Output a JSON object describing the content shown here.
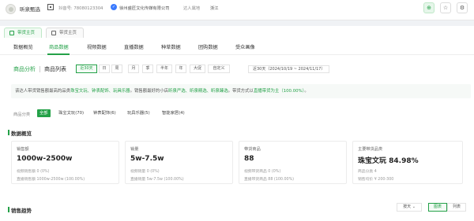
{
  "header": {
    "shop_name": "昕泉甄选",
    "account_label": "抖音号: 78080123304",
    "company": "徐州盛匠文化传媒有限公司",
    "talent_region_label": "达人属地",
    "region": "浙江",
    "icons": [
      "user-plus-icon",
      "star-icon",
      "gear-icon"
    ]
  },
  "host_tabs": [
    {
      "label": "带货主页",
      "active": true
    },
    {
      "label": "带货主页",
      "active": false
    }
  ],
  "tabs": [
    "数据概览",
    "商品数据",
    "视频数据",
    "直播数据",
    "种草数据",
    "团购数据",
    "受众画像"
  ],
  "sub": {
    "analysis": "商品分析",
    "list": "商品列表",
    "periods": [
      "近30天",
      "日",
      "周",
      "月",
      "季",
      "半年",
      "年",
      "大促",
      "自定义"
    ],
    "range": "近30天（2024/10/19 ~ 2024/11/17）"
  },
  "info": {
    "p1": "该达人带货销售额最高的品类",
    "cats": "珠宝文玩、钟表配饰、玩具乐器",
    "p2": "。销售额最好的小店",
    "shops": "昕泉严选、昕泉精选、昕泉臻选",
    "p3": "。带货方式以",
    "mode": "直播带货为主（100.00%）",
    "p4": "。"
  },
  "category": {
    "label": "商品分类",
    "chips": [
      "全部",
      "珠宝文玩(70)",
      "钟表配饰(6)",
      "玩具乐器(5)",
      "智能家居(4)"
    ]
  },
  "overview_title": "数据概览",
  "cards": [
    {
      "label": "销售额",
      "value": "1000w-2500w",
      "sub1": "视频销售额 0 (0%)",
      "sub2": "直播销售额 1000w-2500w (100.00%)",
      "sub3": ""
    },
    {
      "label": "销量",
      "value": "5w-7.5w",
      "sub1": "视频销量 0 (0%)",
      "sub2": "直播销量 5w-7.5w (100.00%)",
      "sub3": ""
    },
    {
      "label": "带货商品",
      "value": "88",
      "sub1": "视频带货商品 0 (0%)",
      "sub2": "直播带货商品 88 (100.00%)",
      "sub3": ""
    },
    {
      "label": "主要带货品类",
      "value": "珠宝文玩 84.98%",
      "sub1": "商品分类 4",
      "sub2": "销售均价 ¥ 200-300",
      "sub3": ""
    }
  ],
  "trend": {
    "title": "销售趋势",
    "by": "按天",
    "view_chart": "图表",
    "view_list": "列表"
  },
  "colors": {
    "accent": "#24a148",
    "verify": "#3a7afe"
  }
}
